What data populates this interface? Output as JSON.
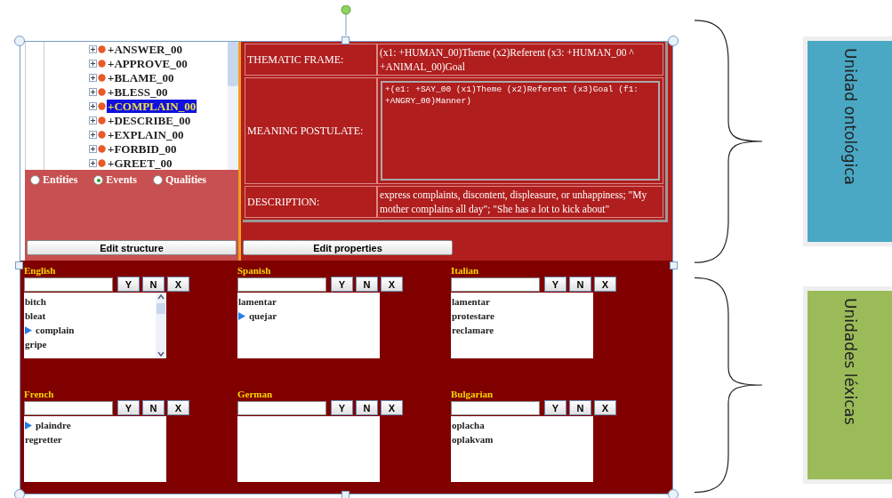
{
  "tree": {
    "items": [
      {
        "label": "+ANSWER_00",
        "selected": false
      },
      {
        "label": "+APPROVE_00",
        "selected": false
      },
      {
        "label": "+BLAME_00",
        "selected": false
      },
      {
        "label": "+BLESS_00",
        "selected": false
      },
      {
        "label": "+COMPLAIN_00",
        "selected": true
      },
      {
        "label": "+DESCRIBE_00",
        "selected": false
      },
      {
        "label": "+EXPLAIN_00",
        "selected": false
      },
      {
        "label": "+FORBID_00",
        "selected": false
      },
      {
        "label": "+GREET_00",
        "selected": false
      }
    ]
  },
  "ontology_types": [
    {
      "label": "Entities",
      "selected": false
    },
    {
      "label": "Events",
      "selected": true
    },
    {
      "label": "Qualities",
      "selected": false
    }
  ],
  "edit_structure_button": "Edit structure",
  "properties": [
    {
      "label": "THEMATIC FRAME:",
      "value": "(x1: +HUMAN_00)Theme (x2)Referent (x3: +HUMAN_00 ^ +ANIMAL_00)Goal",
      "kind": "text"
    },
    {
      "label": "MEANING POSTULATE:",
      "value": "+(e1: +SAY_00 (x1)Theme (x2)Referent (x3)Goal (f1: +ANGRY_00)Manner)",
      "kind": "textarea"
    },
    {
      "label": "DESCRIPTION:",
      "value": "express complaints, discontent, displeasure, or unhappiness; \"My mother complains all day\"; \"She has a lot to kick about\"",
      "kind": "text"
    }
  ],
  "edit_properties_button": "Edit properties",
  "languages": [
    {
      "name": "English",
      "buttons": [
        "Y",
        "N",
        "X"
      ],
      "scrollable": true,
      "words": [
        {
          "text": "bitch",
          "marked": false
        },
        {
          "text": "bleat",
          "marked": false
        },
        {
          "text": "complain",
          "marked": true
        },
        {
          "text": "gripe",
          "marked": false
        }
      ]
    },
    {
      "name": "Spanish",
      "buttons": [
        "Y",
        "N",
        "X"
      ],
      "scrollable": false,
      "words": [
        {
          "text": "lamentar",
          "marked": false
        },
        {
          "text": "quejar",
          "marked": true
        }
      ]
    },
    {
      "name": "Italian",
      "buttons": [
        "Y",
        "N",
        "X"
      ],
      "scrollable": false,
      "words": [
        {
          "text": "lamentar",
          "marked": false
        },
        {
          "text": "protestare",
          "marked": false
        },
        {
          "text": "reclamare",
          "marked": false
        }
      ]
    },
    {
      "name": "French",
      "buttons": [
        "Y",
        "N",
        "X"
      ],
      "scrollable": false,
      "words": [
        {
          "text": "plaindre",
          "marked": true
        },
        {
          "text": "regretter",
          "marked": false
        }
      ]
    },
    {
      "name": "German",
      "buttons": [
        "Y",
        "N",
        "X"
      ],
      "scrollable": false
    },
    {
      "name": "Bulgarian",
      "buttons": [
        "Y",
        "N",
        "X"
      ],
      "scrollable": false,
      "words": [
        {
          "text": "oplacha",
          "marked": false
        },
        {
          "text": "oplakvam",
          "marked": false
        }
      ]
    }
  ],
  "annotations": [
    {
      "label": "Unidad ontológica",
      "color": "#4aa8c4"
    },
    {
      "label": "Unidades léxicas",
      "color": "#9bbb59"
    }
  ]
}
